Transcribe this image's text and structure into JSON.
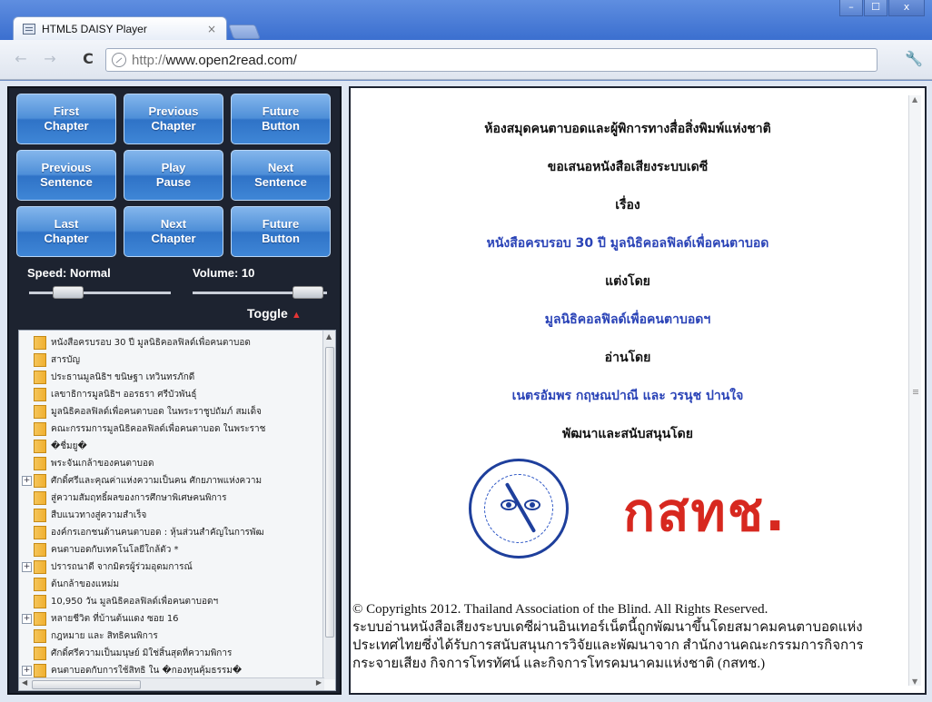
{
  "browser": {
    "tab_title": "HTML5 DAISY Player",
    "tab_close": "×",
    "url_scheme": "http://",
    "url_host": "www.open2read.com/",
    "window_buttons": [
      "–",
      "☐",
      "x"
    ]
  },
  "controls": {
    "buttons": [
      {
        "line1": "First",
        "line2": "Chapter"
      },
      {
        "line1": "Previous",
        "line2": "Chapter"
      },
      {
        "line1": "Future",
        "line2": "Button"
      },
      {
        "line1": "Previous",
        "line2": "Sentence"
      },
      {
        "line1": "Play",
        "line2": "Pause"
      },
      {
        "line1": "Next",
        "line2": "Sentence"
      },
      {
        "line1": "Last",
        "line2": "Chapter"
      },
      {
        "line1": "Next",
        "line2": "Chapter"
      },
      {
        "line1": "Future",
        "line2": "Button"
      }
    ],
    "speed_label": "Speed: Normal",
    "volume_label": "Volume: 10",
    "toggle_label": "Toggle"
  },
  "toc": [
    {
      "expander": "",
      "text": "หนังสือครบรอบ 30 ปี มูลนิธิคอลฟิลด์เพื่อคนตาบอด"
    },
    {
      "expander": "",
      "text": "สารบัญ"
    },
    {
      "expander": "",
      "text": "ประธานมูลนิธิฯ ขนิษฐา เทวินทรภักดี"
    },
    {
      "expander": "",
      "text": "เลขาธิการมูลนิธิฯ ออรธรา ศรีบัวพันธุ์"
    },
    {
      "expander": "",
      "text": "มูลนิธิคอลฟิลด์เพื่อคนตาบอด ในพระราชูปถัมภ์ สมเด็จ"
    },
    {
      "expander": "",
      "text": "คณะกรรมการมูลนิธิคอลฟิลด์เพื่อคนตาบอด ในพระราช"
    },
    {
      "expander": "",
      "text": "�ชื่มยู�"
    },
    {
      "expander": "",
      "text": "พระจันเกล้าของคนตาบอด"
    },
    {
      "expander": "+",
      "text": "ศักดิ์ศรีและคุณค่าแห่งความเป็นคน ศักยภาพแห่งความ"
    },
    {
      "expander": "",
      "text": "สู่ความสัมฤทธิ์ผลของการศึกษาพิเศษคนพิการ"
    },
    {
      "expander": "",
      "text": "สืบแนวทางสู่ความสำเร็จ"
    },
    {
      "expander": "",
      "text": "องค์กรเอกชนด้านคนตาบอด : หุ้นส่วนสำคัญในการพัฒ"
    },
    {
      "expander": "",
      "text": "คนตาบอดกับเทคโนโลยีใกล้ตัว *"
    },
    {
      "expander": "+",
      "text": "ปรารถนาดี จากมิตรผู้ร่วมอุดมการณ์"
    },
    {
      "expander": "",
      "text": "ต้นกล้าของแหม่ม"
    },
    {
      "expander": "",
      "text": "10,950 วัน มูลนิธิคอลฟิลด์เพื่อคนตาบอดฯ"
    },
    {
      "expander": "+",
      "text": "หลายชีวิต ที่บ้านต้นแดง ซอย 16"
    },
    {
      "expander": "",
      "text": "กฎหมาย และ สิทธิคนพิการ"
    },
    {
      "expander": "",
      "text": "ศักดิ์ศรีความเป็นมนุษย์ มิใช่สิ้นสุดที่ความพิการ"
    },
    {
      "expander": "+",
      "text": "คนตาบอดกับการใช้สิทธิ ใน �กองทุนคุ้มธรรม�"
    }
  ],
  "content": {
    "line1": "ห้องสมุดคนตาบอดและผู้พิการทางสื่อสิ่งพิมพ์แห่งชาติ",
    "line2": "ขอเสนอหนังสือเสียงระบบเดซี",
    "line3": "เรื่อง",
    "book_title": "หนังสือครบรอบ 30 ปี มูลนิธิคอลฟิลด์เพื่อคนตาบอด",
    "line5": "แต่งโดย",
    "author": "มูลนิธิคอลฟิลด์เพื่อคนตาบอดฯ",
    "line7": "อ่านโดย",
    "reader": "เนตรอัมพร กฤษณปาณี และ วรนุช ปานใจ",
    "line9": "พัฒนาและสนับสนุนโดย",
    "brand": "กสทช.",
    "copyright_en": "© Copyrights 2012. Thailand Association of the Blind. All Rights Reserved.",
    "copyright_th": "ระบบอ่านหนังสือเสียงระบบเดซีผ่านอินเทอร์เน็ตนี้ถูกพัฒนาขึ้นโดยสมาคมคนตาบอดแห่งประเทศไทยซึ่งได้รับการสนับสนุนการวิจัยและพัฒนาจาก สำนักงานคณะกรรมการกิจการกระจายเสียง กิจการโทรทัศน์ และกิจการโทรคมนาคมแห่งชาติ (กสทช.)"
  },
  "colors": {
    "button_blue": "#3f86d6",
    "panel_dark": "#1d2330",
    "link_blue": "#2a43b7",
    "brand_red": "#d7281f"
  }
}
